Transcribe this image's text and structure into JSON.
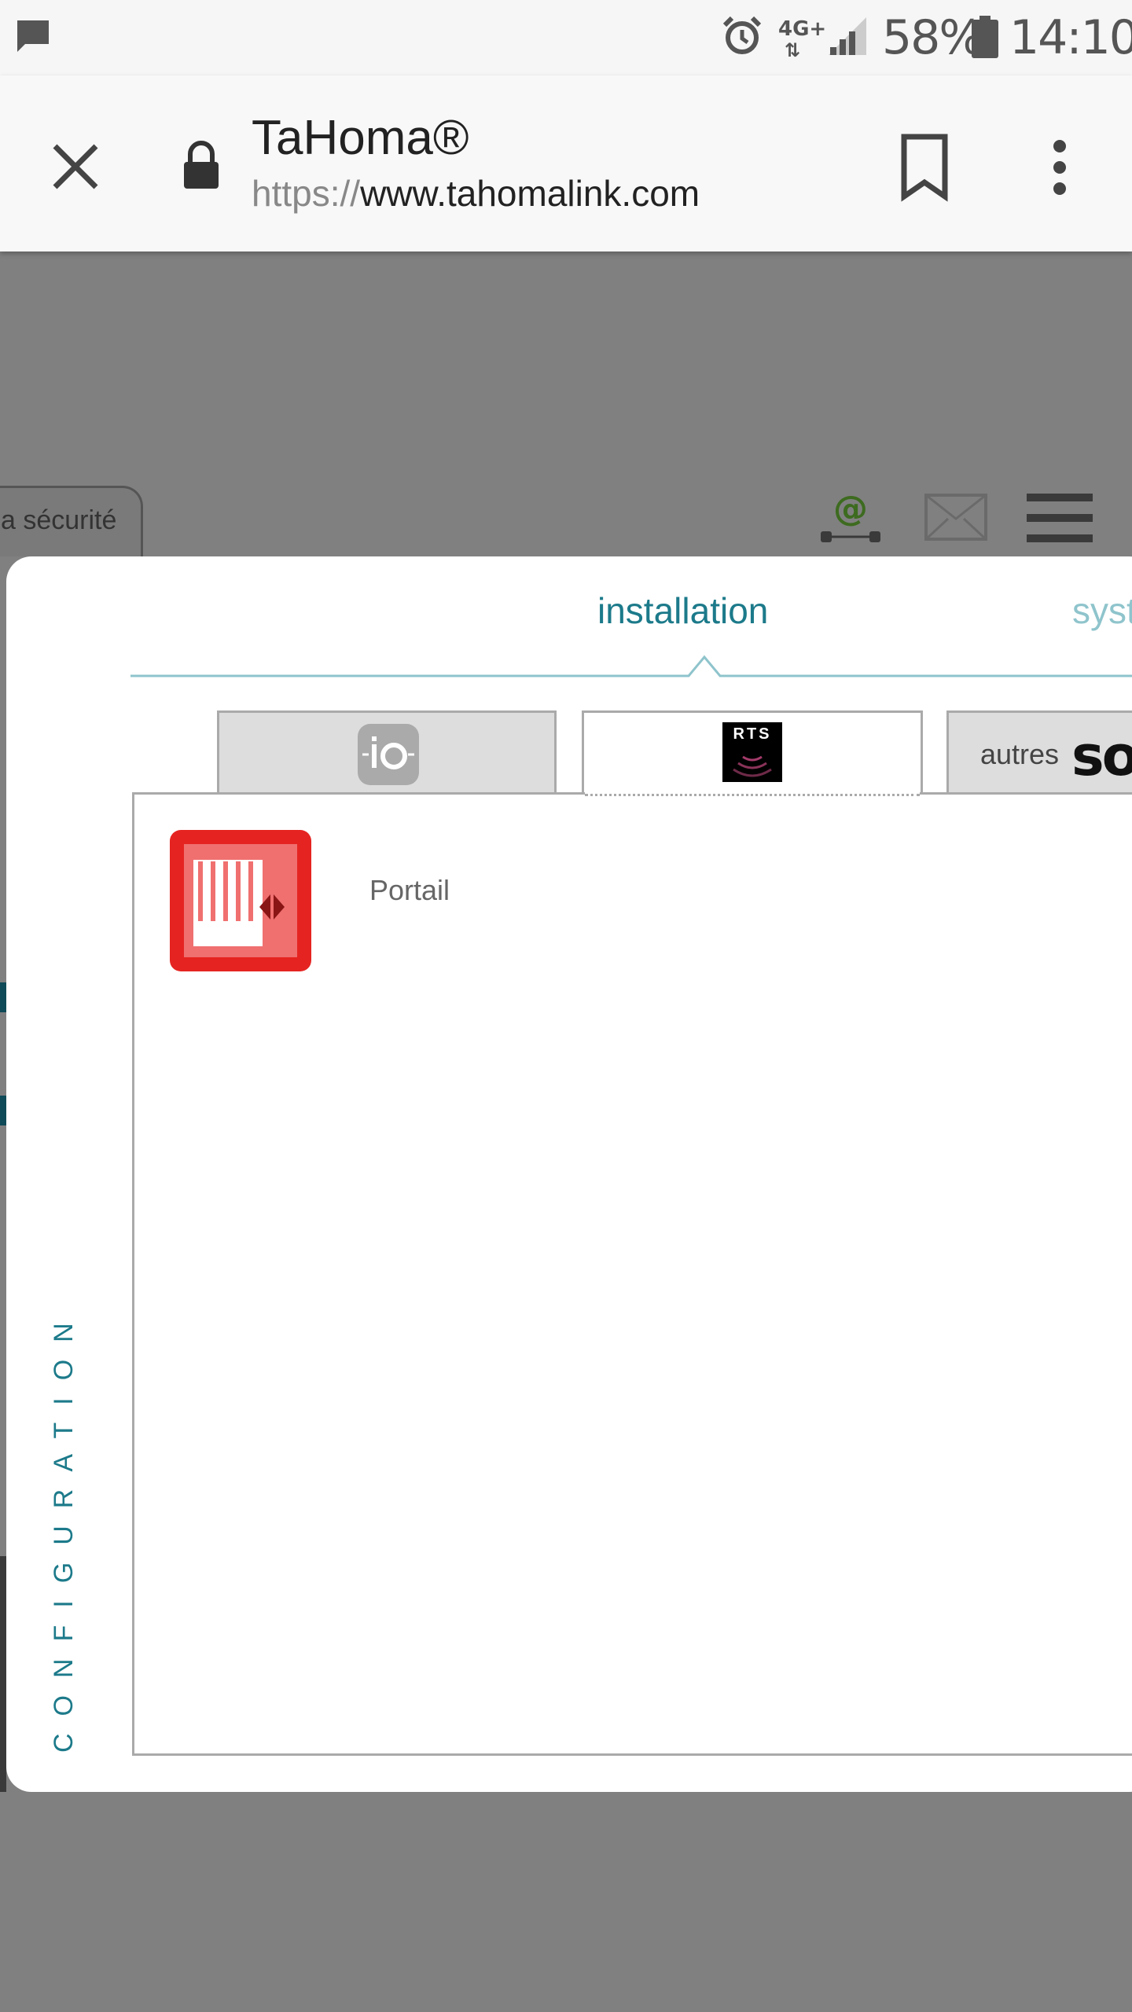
{
  "status_bar": {
    "network": "4G+",
    "battery": "58%",
    "time": "14:10"
  },
  "browser": {
    "title": "TaHoma®",
    "url_scheme": "https://",
    "url_host": "www.tahomalink.com"
  },
  "background": {
    "tab_label": "a sécurité"
  },
  "modal": {
    "side_label": "CONFIGURATION",
    "tabs": [
      {
        "label": "installation",
        "active": true
      },
      {
        "label": "syst",
        "active": false
      }
    ],
    "protocols": [
      {
        "label": "io",
        "active": false
      },
      {
        "label": "RTS",
        "active": true
      },
      {
        "label": "autres",
        "brand": "so",
        "active": false
      }
    ],
    "devices": [
      {
        "label": "Portail",
        "icon": "gate-icon"
      }
    ]
  },
  "colors": {
    "accent": "#1c7a8a",
    "accent_light": "#8fc4cc",
    "device_red": "#e52421",
    "overlay": "#808080"
  }
}
